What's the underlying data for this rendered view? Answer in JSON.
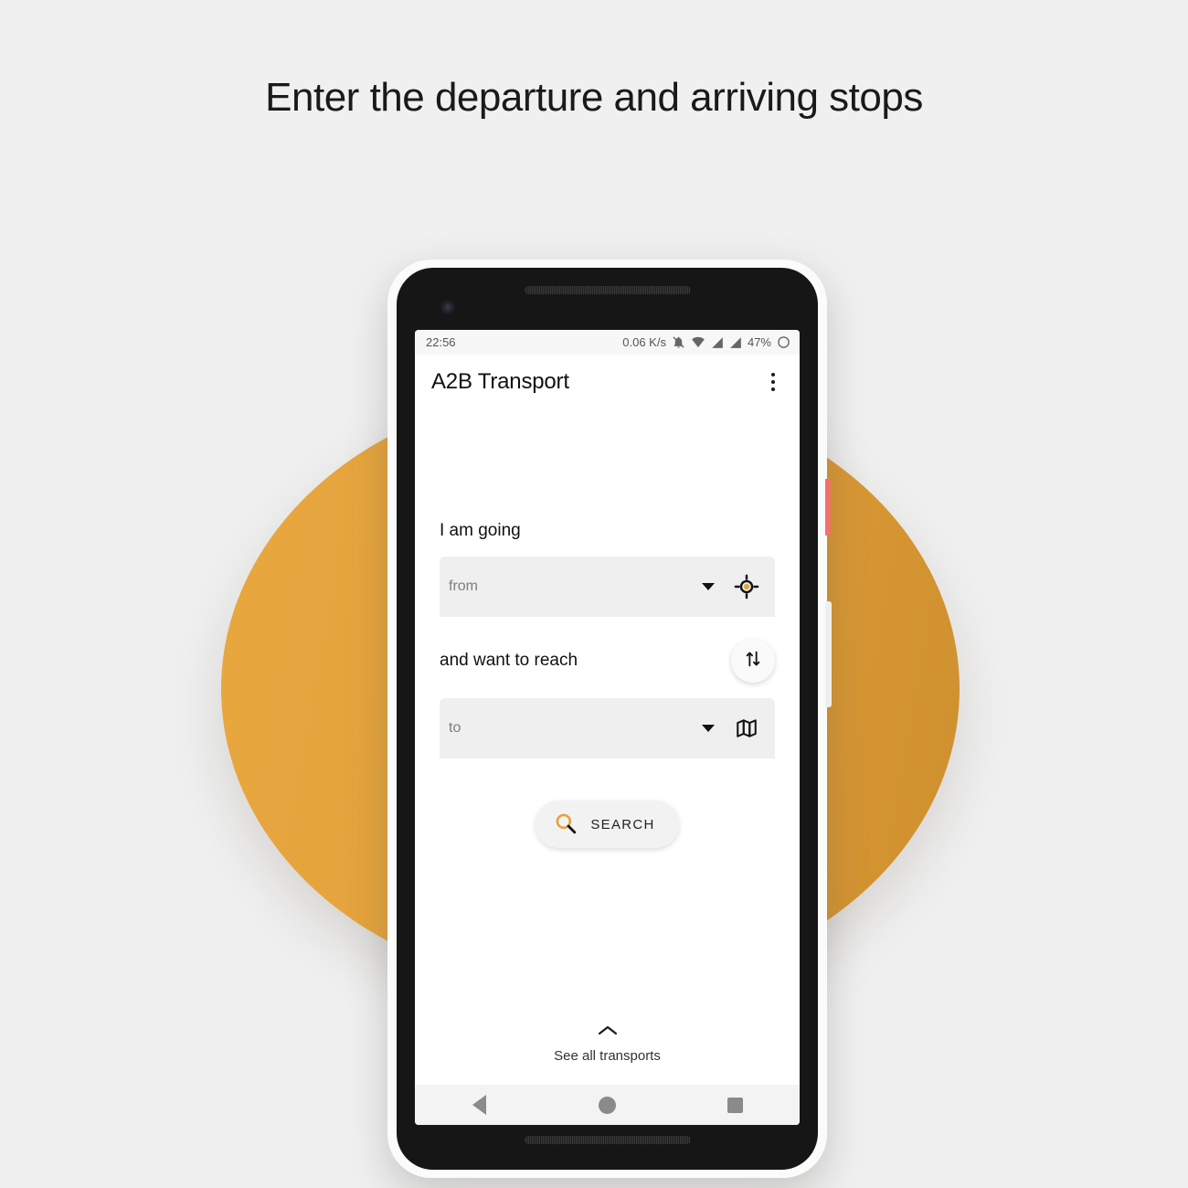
{
  "page": {
    "headline": "Enter the departure and arriving stops",
    "background_color": "#F0F0F0",
    "accent_color": "#E3A13B"
  },
  "device": {
    "frame_color": "#FBFBFB",
    "body_color": "#161616",
    "power_button_color": "#F2716A",
    "volume_button_color": "#EFEFEF"
  },
  "status_bar": {
    "clock": "22:56",
    "network_speed": "0.06 K/s",
    "battery_percent": "47%",
    "icons": [
      "bell-off-icon",
      "wifi-icon",
      "signal-icon",
      "signal-icon",
      "battery-icon"
    ]
  },
  "app_bar": {
    "title": "A2B Transport",
    "overflow_icon": "more-vertical-icon"
  },
  "form": {
    "from_label": "I am going",
    "from_placeholder": "from",
    "from_action_icon": "my-location-icon",
    "to_label": "and want to reach",
    "to_placeholder": "to",
    "to_action_icon": "map-icon",
    "swap_icon": "swap-vertical-icon",
    "dropdown_icon": "chevron-down-icon"
  },
  "search": {
    "label": "SEARCH",
    "icon": "search-icon",
    "icon_color": "#E0A43C"
  },
  "bottom_sheet": {
    "label": "See all transports",
    "icon": "chevron-up-icon"
  },
  "nav_bar": {
    "back": "back-icon",
    "home": "home-icon",
    "recents": "recents-icon"
  }
}
